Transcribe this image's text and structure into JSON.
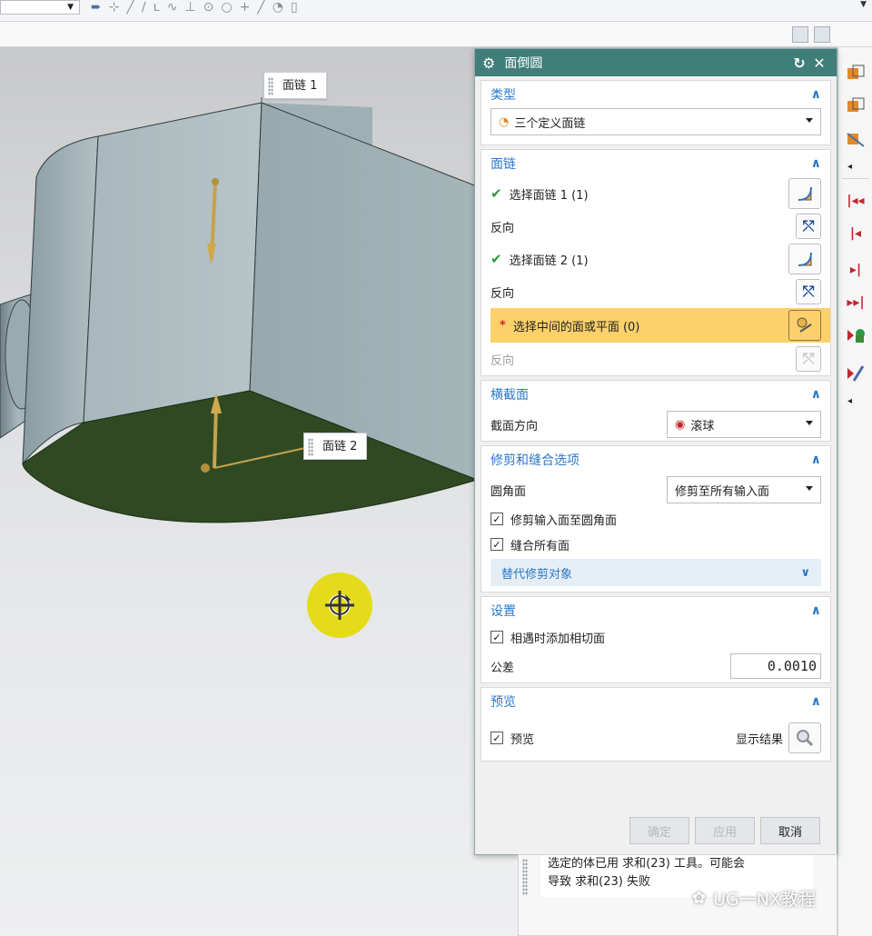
{
  "viewport": {
    "callout_1": "面链 1",
    "callout_2": "面链 2"
  },
  "dialog": {
    "title": "面倒圆",
    "type_group": {
      "title": "类型",
      "selected": "三个定义面链"
    },
    "face_chain_group": {
      "title": "面链",
      "select_chain_1": "选择面链 1 (1)",
      "reverse_1": "反向",
      "select_chain_2": "选择面链 2 (1)",
      "reverse_2": "反向",
      "select_middle": "选择中间的面或平面 (0)",
      "reverse_3": "反向"
    },
    "cross_section_group": {
      "title": "横截面",
      "orientation_label": "截面方向",
      "orientation_value": "滚球"
    },
    "trim_group": {
      "title": "修剪和缝合选项",
      "blend_face_label": "圆角面",
      "blend_face_value": "修剪至所有输入面",
      "trim_input_label": "修剪输入面至圆角面",
      "trim_input_checked": true,
      "sew_all_label": "缝合所有面",
      "sew_all_checked": true,
      "alt_trim_label": "替代修剪对象"
    },
    "settings_group": {
      "title": "设置",
      "add_tangent_label": "相遇时添加相切面",
      "add_tangent_checked": true,
      "tolerance_label": "公差",
      "tolerance_value": "0.0010"
    },
    "preview_group": {
      "title": "预览",
      "preview_label": "预览",
      "preview_checked": true,
      "show_result_label": "显示结果"
    },
    "footer": {
      "ok": "确定",
      "apply": "应用",
      "cancel": "取消"
    }
  },
  "info_message": {
    "line1": "选定的体已用 求和(23) 工具。可能会",
    "line2": "导致 求和(23) 失败"
  },
  "watermark": "UG一NX教程",
  "colors": {
    "title_bar": "#3f7e79",
    "group_header": "#2a78c9",
    "active_row": "#fcd06b",
    "selected_face": "#2f4a23",
    "cursor_highlight": "#e4dc1a"
  },
  "icons": {
    "toolbar": [
      "select-icon",
      "line-icon",
      "arc-icon",
      "spline-icon",
      "point-icon",
      "circle-icon",
      "plus-icon",
      "snap-icon"
    ],
    "right_toolbar": [
      "cube-add-icon",
      "cube-subtract-icon",
      "cube-intersect-icon",
      "first-icon",
      "previous-icon",
      "next-icon",
      "last-icon",
      "play-shape-icon",
      "edit-sketch-icon"
    ]
  }
}
